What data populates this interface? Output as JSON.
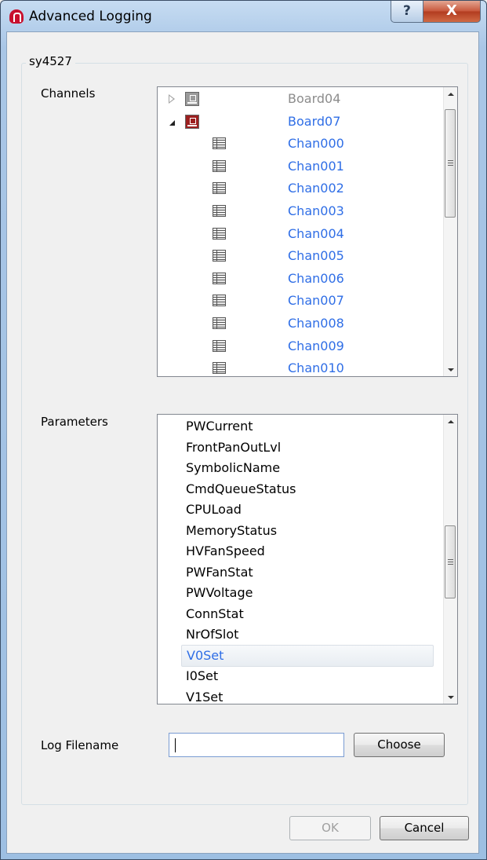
{
  "window": {
    "title": "Advanced Logging",
    "help_label": "?",
    "close_label": "X"
  },
  "group": {
    "title": "sy4527"
  },
  "channels": {
    "label": "Channels",
    "items": [
      {
        "label": "Board04",
        "kind": "board",
        "state": "collapsed",
        "color": "#8c8c8c"
      },
      {
        "label": "Board07",
        "kind": "board",
        "state": "expanded",
        "color": "#2f6ee6"
      },
      {
        "label": "Chan000",
        "kind": "channel"
      },
      {
        "label": "Chan001",
        "kind": "channel"
      },
      {
        "label": "Chan002",
        "kind": "channel"
      },
      {
        "label": "Chan003",
        "kind": "channel"
      },
      {
        "label": "Chan004",
        "kind": "channel"
      },
      {
        "label": "Chan005",
        "kind": "channel"
      },
      {
        "label": "Chan006",
        "kind": "channel"
      },
      {
        "label": "Chan007",
        "kind": "channel"
      },
      {
        "label": "Chan008",
        "kind": "channel"
      },
      {
        "label": "Chan009",
        "kind": "channel"
      },
      {
        "label": "Chan010",
        "kind": "channel"
      }
    ]
  },
  "parameters": {
    "label": "Parameters",
    "selected": "V0Set",
    "items": [
      "PWCurrent",
      "FrontPanOutLvl",
      "SymbolicName",
      "CmdQueueStatus",
      "CPULoad",
      "MemoryStatus",
      "HVFanSpeed",
      "PWFanStat",
      "PWVoltage",
      "ConnStat",
      "NrOfSlot",
      "V0Set",
      "I0Set",
      "V1Set"
    ]
  },
  "log": {
    "label": "Log Filename",
    "value": "",
    "choose_label": "Choose"
  },
  "footer": {
    "ok_label": "OK",
    "cancel_label": "Cancel"
  },
  "colors": {
    "accent": "#2f6ee6",
    "disabled_text": "#a0a0a0",
    "board_red": "#9c1f1f"
  }
}
